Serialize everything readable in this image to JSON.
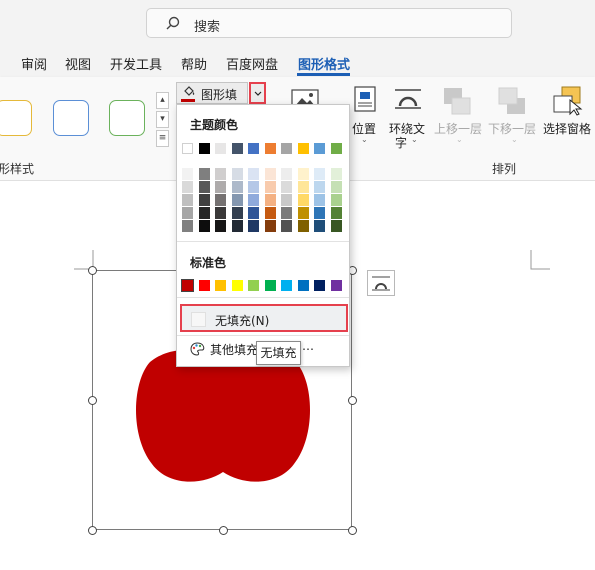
{
  "search": {
    "placeholder": "搜索"
  },
  "tabs": [
    {
      "label": "审阅"
    },
    {
      "label": "视图"
    },
    {
      "label": "开发工具"
    },
    {
      "label": "帮助"
    },
    {
      "label": "百度网盘"
    },
    {
      "label": "图形格式",
      "active": true
    }
  ],
  "ribbon": {
    "style_group_label": "形样式",
    "fill_button_label": "图形填充",
    "position_label": "位置",
    "wrap_text_label_line1": "环绕文",
    "wrap_text_label_line2": "字",
    "bring_forward_label": "上移一层",
    "send_backward_label": "下移一层",
    "selection_pane_label": "选择窗格",
    "arrange_group_label": "排列"
  },
  "fill_menu": {
    "theme_colors_label": "主题颜色",
    "standard_colors_label": "标准色",
    "no_fill_label": "无填充(N)",
    "more_fill_label": "其他填充",
    "more_fill_suffix": "…",
    "theme_top_row": [
      "#ffffff",
      "#000000",
      "#e7e6e6",
      "#44546a",
      "#4472c4",
      "#ed7d31",
      "#a5a5a5",
      "#ffc000",
      "#5b9bd5",
      "#70ad47"
    ],
    "theme_columns": [
      [
        "#f2f2f2",
        "#d9d9d9",
        "#bfbfbf",
        "#a6a6a6",
        "#808080"
      ],
      [
        "#7f7f7f",
        "#595959",
        "#404040",
        "#262626",
        "#0d0d0d"
      ],
      [
        "#d0cece",
        "#aeabab",
        "#757171",
        "#3a3838",
        "#171616"
      ],
      [
        "#d6dce5",
        "#adb9ca",
        "#8497b0",
        "#333f50",
        "#222a35"
      ],
      [
        "#dae3f3",
        "#b4c7e7",
        "#8faadc",
        "#2f5597",
        "#1f3864"
      ],
      [
        "#fbe5d6",
        "#f8cbad",
        "#f4b183",
        "#c55a11",
        "#843c0c"
      ],
      [
        "#ededed",
        "#dbdbdb",
        "#c9c9c9",
        "#7b7b7b",
        "#525252"
      ],
      [
        "#fff2cc",
        "#ffe699",
        "#ffd966",
        "#bf9000",
        "#7f6000"
      ],
      [
        "#deebf7",
        "#bdd7ee",
        "#9dc3e6",
        "#2e75b6",
        "#1f4e79"
      ],
      [
        "#e2f0d9",
        "#c5e0b4",
        "#a9d18e",
        "#548235",
        "#385723"
      ]
    ],
    "standard_colors": [
      "#c00000",
      "#ff0000",
      "#ffc000",
      "#ffff00",
      "#92d050",
      "#00b050",
      "#00b0f0",
      "#0070c0",
      "#002060",
      "#7030a0"
    ]
  },
  "tooltip": {
    "text": "无填充"
  },
  "shape": {
    "fill_color": "#c00000"
  },
  "accent_color": "#1d5fb5",
  "highlight_color": "#e5404d"
}
